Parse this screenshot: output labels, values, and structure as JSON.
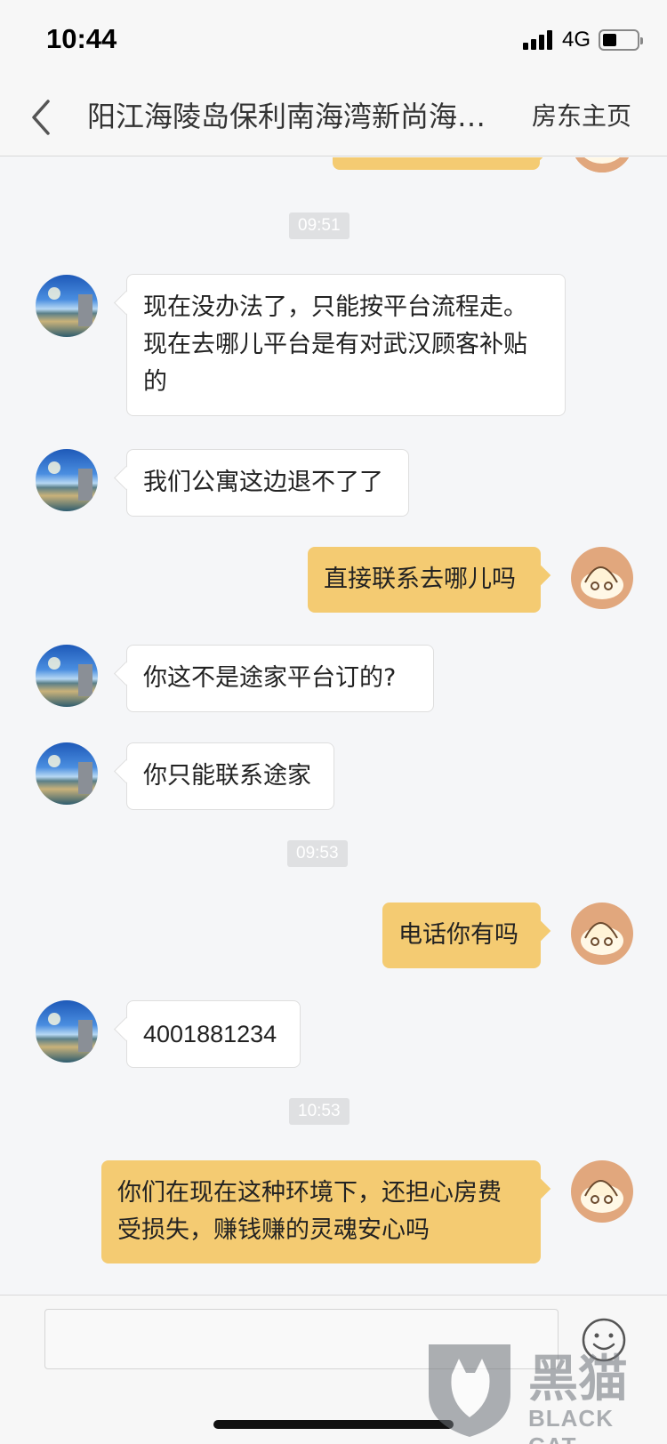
{
  "status_bar": {
    "time": "10:44",
    "network": "4G"
  },
  "nav": {
    "title": "阳江海陵岛保利南海湾新尚海…",
    "right_link": "房东主页"
  },
  "chat": {
    "timestamps": [
      "09:51",
      "09:53",
      "10:53"
    ],
    "messages": [
      {
        "from": "host",
        "text_lines": [
          "现在没办法了，只能按平台流程走。",
          "现在去哪儿平台是有对武汉顾客补贴",
          "的"
        ]
      },
      {
        "from": "host",
        "text": "我们公寓这边退不了了"
      },
      {
        "from": "user",
        "text": "直接联系去哪儿吗"
      },
      {
        "from": "host",
        "text": "你这不是途家平台订的?"
      },
      {
        "from": "host",
        "text": "你只能联系途家"
      },
      {
        "from": "user",
        "text": "电话你有吗"
      },
      {
        "from": "host",
        "text": "4001881234"
      },
      {
        "from": "user",
        "text_lines": [
          "你们在现在这种环境下，还担心房费",
          "受损失，赚钱赚的灵魂安心吗"
        ]
      }
    ]
  },
  "watermark": {
    "cn": "黑猫",
    "en": "BLACK CAT"
  },
  "colors": {
    "outgoing_bubble": "#f4cb72",
    "incoming_bubble": "#ffffff",
    "background": "#f5f6f8"
  }
}
